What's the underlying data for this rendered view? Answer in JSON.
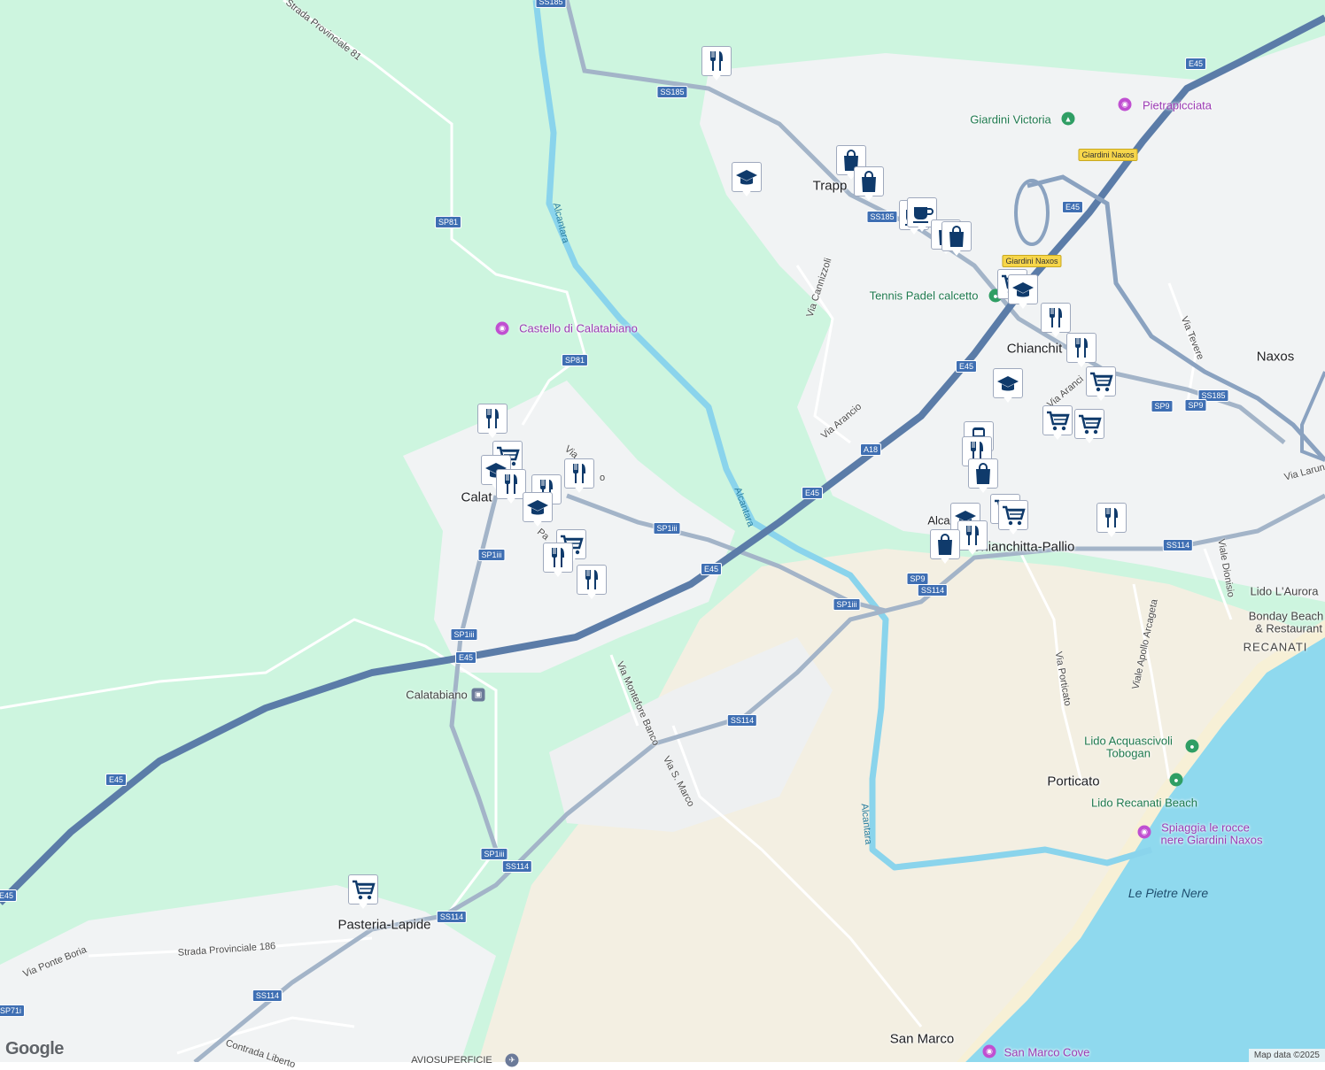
{
  "map": {
    "colors": {
      "vegetation": "#cdf5df",
      "urban": "#f1f3f4",
      "sand": "#f3efe2",
      "sea": "#8fd9ee",
      "river": "#8ad4ec",
      "highway": "#5b7ca8",
      "road": "#ffffff",
      "pin_icon": "#0f3a6b"
    },
    "towns": {
      "trappitello": "Trapp",
      "calatabiano": "Calat",
      "chianchitta": "Chianchit",
      "naxos": "Naxos",
      "chianchitta_pallio": "Chianchitta-Pallio",
      "alcantara": "Alca",
      "porticato": "Porticato",
      "pasteria": "Pasteria-Lapide",
      "san_marco": "San Marco",
      "recanati": "RECANATI"
    },
    "streets": {
      "provinciale_81": "Strada Provinciale 81",
      "cannizzoli": "Via Cannizzoli",
      "arancio": "Via Arancio",
      "arancio2": "Via Aranci",
      "tevere": "Via Tevere",
      "larunda": "Via Larund",
      "dionisio": "Viale Dionisio",
      "apollo": "Viale Apollo Arcageta",
      "porticato": "Via Porticato",
      "montefore": "Via Montefore Banco",
      "s_marco": "Via S. Marco",
      "provinciale_186": "Strada Provinciale 186",
      "ponte_boria": "Via Ponte Boria",
      "liberto": "Contrada Liberto",
      "via_calat1": "Via",
      "via_calat2": "o",
      "via_calat3": "Pa"
    },
    "rivers": {
      "alcantara_1": "Alcantara",
      "alcantara_2": "Alcantara",
      "alcantara_3": "Alcantara"
    },
    "pois": {
      "castello": "Castello di Calatabiano",
      "pietrapicciata": "Pietrapicciata",
      "giardini_victoria": "Giardini Victoria",
      "tennis": "Tennis Padel calcetto",
      "calatabiano_station": "Calatabiano",
      "lido_aurora": "Lido L'Aurora",
      "bonday_1": "Bonday Beach",
      "bonday_2": "& Restaurant",
      "acquascivoli_1": "Lido Acquascivoli",
      "acquascivoli_2": "Tobogan",
      "lido_recanati": "Lido Recanati Beach",
      "spiaggia_1": "Spiaggia le rocce",
      "spiaggia_2": "nere Giardini Naxos",
      "pietre_nere": "Le Pietre Nere",
      "san_marco_cove": "San Marco Cove",
      "avio": "AVIOSUPERFICIE"
    },
    "shields": {
      "ss185_top": "SS185",
      "ss185_a": "SS185",
      "ss185_b": "SS185",
      "ss185_c": "SS185",
      "sp81_a": "SP81",
      "sp81_b": "SP81",
      "e45_a": "E45",
      "e45_b": "E45",
      "e45_c": "E45",
      "e45_d": "E45",
      "e45_e": "E45",
      "e45_f": "E45",
      "e45_g": "E45",
      "e45_h": "E45",
      "a18": "A18",
      "sp1iii_a": "SP1iii",
      "sp1iii_b": "SP1iii",
      "sp1iii_c": "SP1iii",
      "sp1iii_d": "SP1iii",
      "sp1iii_e": "SP1iii",
      "ss114_a": "SS114",
      "ss114_b": "SS114",
      "ss114_c": "SS114",
      "ss114_d": "SS114",
      "ss114_e": "SS114",
      "ss114_f": "SS114",
      "sp9_a": "SP9",
      "sp9_b": "SP9",
      "sp9_c": "SP9",
      "sp71": "SP71i",
      "giardini_naxos_a": "Giardini Naxos",
      "giardini_naxos_b": "Giardini Naxos"
    },
    "markers": [
      {
        "type": "restaurant"
      },
      {
        "type": "school"
      },
      {
        "type": "shopping"
      },
      {
        "type": "shopping"
      },
      {
        "type": "cafe"
      },
      {
        "type": "cafe"
      },
      {
        "type": "shopping"
      },
      {
        "type": "shopping"
      },
      {
        "type": "grocery"
      },
      {
        "type": "school"
      },
      {
        "type": "restaurant"
      },
      {
        "type": "restaurant"
      },
      {
        "type": "school"
      },
      {
        "type": "grocery"
      },
      {
        "type": "grocery"
      },
      {
        "type": "grocery"
      },
      {
        "type": "transit"
      },
      {
        "type": "restaurant"
      },
      {
        "type": "shopping"
      },
      {
        "type": "school"
      },
      {
        "type": "restaurant"
      },
      {
        "type": "grocery"
      },
      {
        "type": "grocery"
      },
      {
        "type": "restaurant"
      },
      {
        "type": "shopping"
      },
      {
        "type": "restaurant"
      },
      {
        "type": "grocery"
      },
      {
        "type": "school"
      },
      {
        "type": "restaurant"
      },
      {
        "type": "restaurant"
      },
      {
        "type": "school"
      },
      {
        "type": "grocery"
      },
      {
        "type": "restaurant"
      },
      {
        "type": "restaurant"
      },
      {
        "type": "restaurant"
      },
      {
        "type": "grocery"
      }
    ]
  },
  "footer": {
    "logo": "Google",
    "attribution": "Map data ©2025"
  }
}
